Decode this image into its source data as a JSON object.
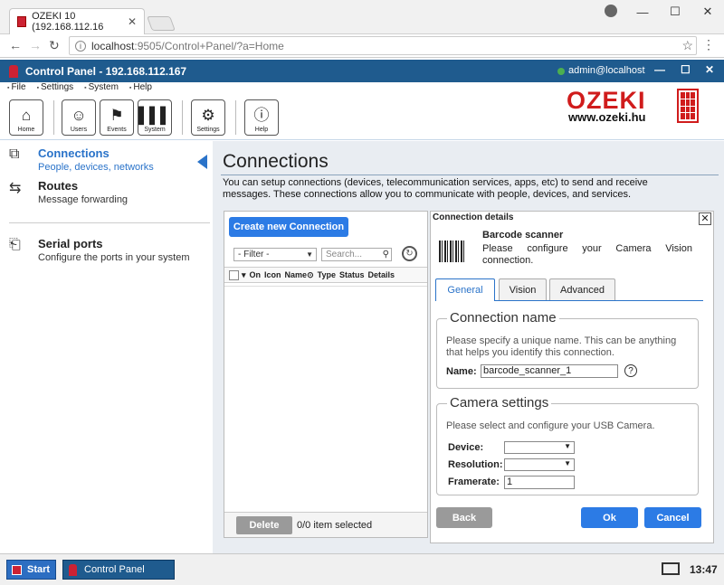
{
  "browser": {
    "tab_title": "OZEKI 10 (192.168.112.16",
    "tab_close": "✕",
    "url_host": "localhost",
    "url_rest": ":9505/Control+Panel/?a=Home",
    "win_min": "—",
    "win_max": "☐",
    "win_close": "✕"
  },
  "app": {
    "title": "Control Panel - 192.168.112.167",
    "user": "admin@localhost",
    "ctl_min": "—",
    "ctl_max": "☐",
    "ctl_close": "✕"
  },
  "menu": [
    "File",
    "Settings",
    "System",
    "Help"
  ],
  "toolbar": {
    "home": "Home",
    "users": "Users",
    "events": "Events",
    "system": "System",
    "settings": "Settings",
    "help": "Help"
  },
  "logo": {
    "brand": "OZEKI",
    "site": "www.ozeki.hu"
  },
  "sidebar": {
    "items": [
      {
        "title": "Connections",
        "sub": "People, devices, networks",
        "icon": "connections-icon"
      },
      {
        "title": "Routes",
        "sub": "Message forwarding",
        "icon": "routes-icon"
      },
      {
        "title": "Serial ports",
        "sub": "Configure the ports in your system",
        "icon": "serial-port-icon"
      }
    ]
  },
  "main": {
    "title": "Connections",
    "desc": "You can setup connections (devices, telecommunication services, apps, etc) to send and receive messages. These connections allow you to communicate with people, devices, and services."
  },
  "list": {
    "create": "Create new Connection",
    "filter": "- Filter -",
    "search_placeholder": "Search...",
    "columns": [
      "On",
      "Icon",
      "Name",
      "Type",
      "Status",
      "Details"
    ],
    "delete": "Delete",
    "selected": "0/0 item selected"
  },
  "details": {
    "title": "Connection details",
    "name": "Barcode scanner",
    "desc": "Please configure your Camera Vision connection.",
    "tabs": [
      "General",
      "Vision",
      "Advanced"
    ],
    "conn_legend": "Connection name",
    "conn_text": "Please specify a unique name. This can be anything that helps you identify this connection.",
    "name_label": "Name:",
    "name_value": "barcode_scanner_1",
    "cam_legend": "Camera settings",
    "cam_text": "Please select and configure your USB Camera.",
    "device_label": "Device:",
    "device_value": "",
    "resolution_label": "Resolution:",
    "resolution_value": "",
    "framerate_label": "Framerate:",
    "framerate_value": "1",
    "back": "Back",
    "ok": "Ok",
    "cancel": "Cancel"
  },
  "taskbar": {
    "start": "Start",
    "task": "Control Panel",
    "time": "13:47"
  }
}
